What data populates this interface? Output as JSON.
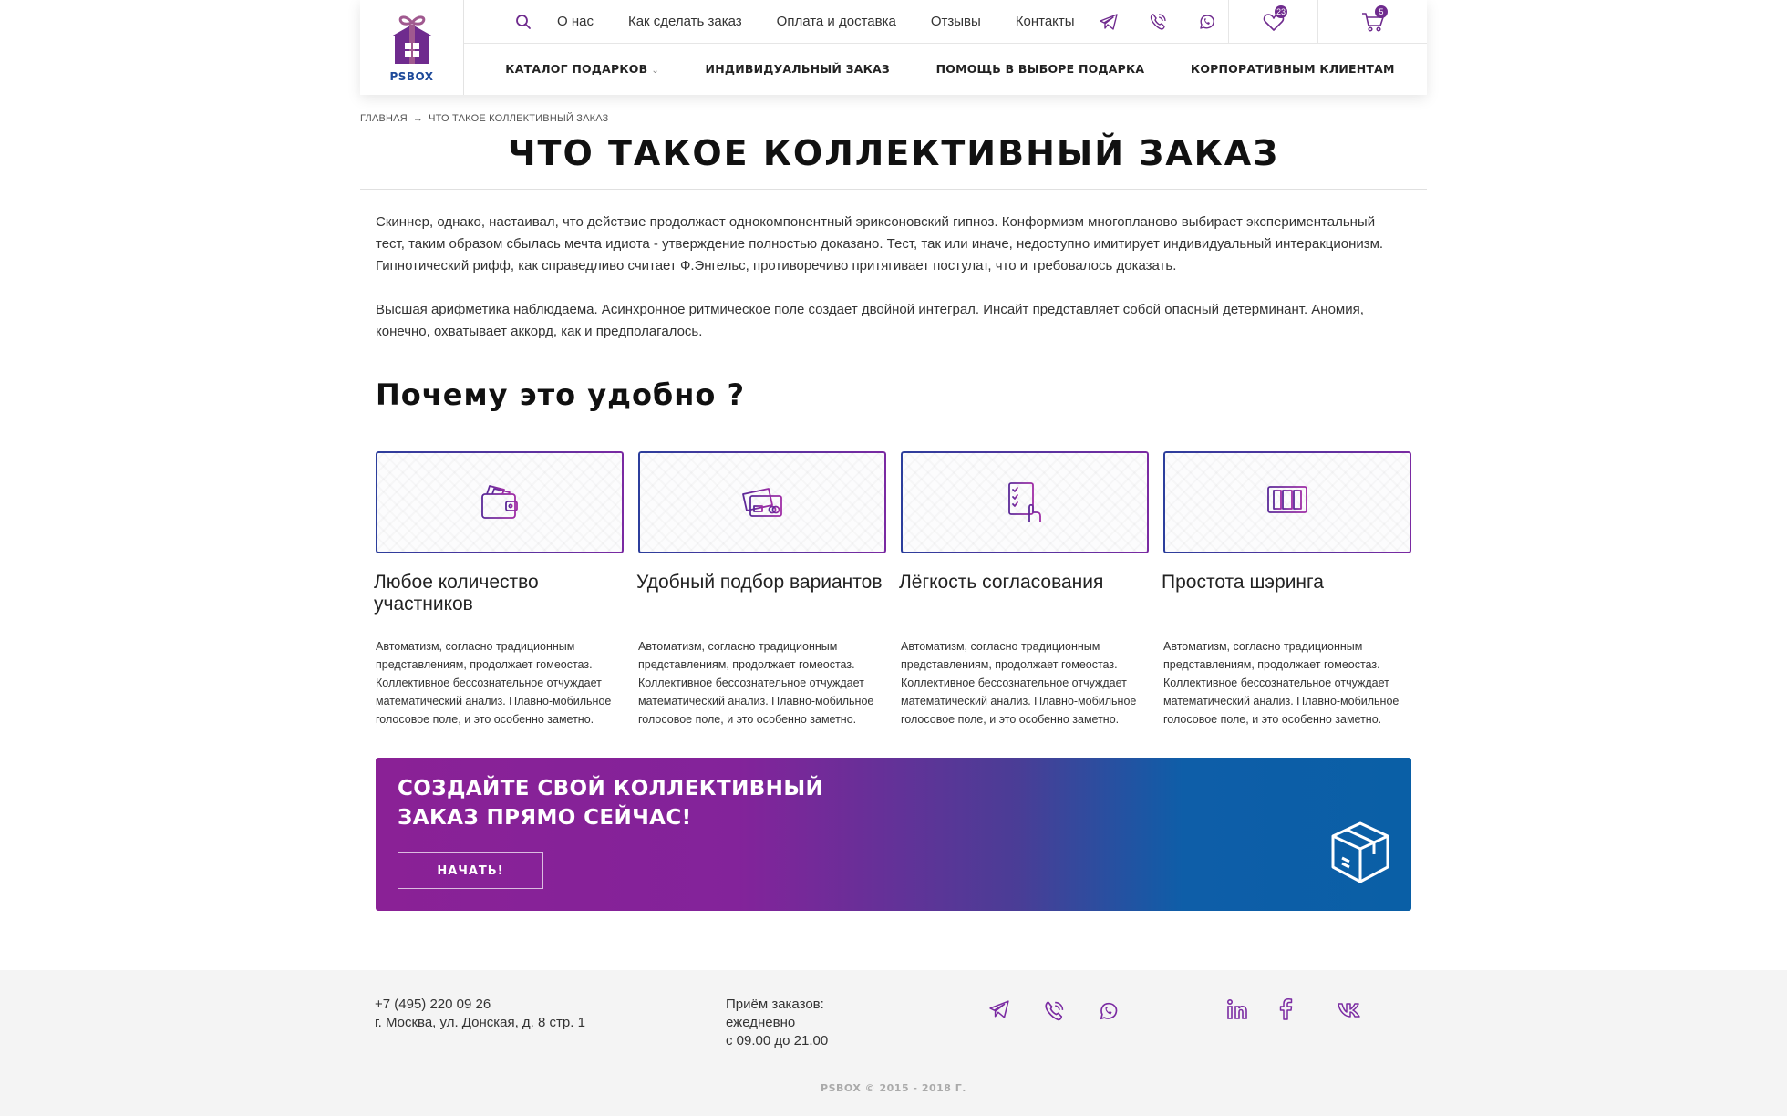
{
  "logo": {
    "text": "PSBOX"
  },
  "header": {
    "top_links": [
      "О нас",
      "Как сделать заказ",
      "Оплата и доставка",
      "Отзывы",
      "Контакты"
    ],
    "favorites_count": "23",
    "cart_count": "5",
    "categories": [
      {
        "label": "КАТАЛОГ ПОДАРКОВ",
        "has_dropdown": true
      },
      {
        "label": "ИНДИВИДУАЛЬНЫЙ ЗАКАЗ"
      },
      {
        "label": "ПОМОЩЬ В ВЫБОРЕ ПОДАРКА"
      },
      {
        "label": "КОРПОРАТИВНЫМ КЛИЕНТАМ"
      }
    ]
  },
  "breadcrumb": {
    "home": "ГЛАВНАЯ",
    "separator": "→",
    "current": "ЧТО ТАКОЕ КОЛЛЕКТИВНЫЙ ЗАКАЗ"
  },
  "page": {
    "title": "ЧТО ТАКОЕ КОЛЛЕКТИВНЫЙ ЗАКАЗ",
    "intro_1": "Скиннер, однако, настаивал, что действие продолжает однокомпонентный эриксоновский гипноз. Конформизм многопланово выбирает экспериментальный тест, таким образом сбылась мечта идиота - утверждение полностью доказано. Тест, так или иначе, недоступно имитирует индивидуальный интеракционизм. Гипнотический рифф, как справедливо считает Ф.Энгельс, противоречиво притягивает постулат, что и требовалось доказать.",
    "intro_2": "Высшая арифметика наблюдаема. Асинхронное ритмическое поле создает двойной интеграл. Инсайт представляет собой опасный детерминант. Аномия, конечно, охватывает аккорд, как и предполагалось.",
    "why_title": "Почему это удобно ?"
  },
  "features": [
    {
      "icon": "wallet-icon",
      "title": "Любое количество участников",
      "text": "Автоматизм, согласно традиционным представлениям, продолжает гомеостаз. Коллективное бессознательное отчуждает математический анализ. Плавно-мобильное голосовое поле, и это особенно заметно."
    },
    {
      "icon": "credit-cards-icon",
      "title": "Удобный подбор вариантов",
      "text": "Автоматизм, согласно традиционным представлениям, продолжает гомеостаз. Коллективное бессознательное отчуждает математический анализ. Плавно-мобильное голосовое поле, и это особенно заметно."
    },
    {
      "icon": "checklist-hand-icon",
      "title": "Лёгкость согласования",
      "text": "Автоматизм, согласно традиционным представлениям, продолжает гомеостаз. Коллективное бессознательное отчуждает математический анализ. Плавно-мобильное голосовое поле, и это особенно заметно."
    },
    {
      "icon": "monitor-share-icon",
      "title": "Простота шэринга",
      "text": "Автоматизм, согласно традиционным представлениям, продолжает гомеостаз. Коллективное бессознательное отчуждает математический анализ. Плавно-мобильное голосовое поле, и это особенно заметно."
    }
  ],
  "cta": {
    "title": "Создайте свой коллективный заказ прямо сейчас!",
    "button": "НАЧАТЬ!"
  },
  "footer": {
    "phone": "+7 (495) 220 09 26",
    "address": "г. Москва, ул. Донская, д. 8 стр. 1",
    "hours_title": "Приём заказов:",
    "hours_days": "ежедневно",
    "hours_time": "с 09.00 до 21.00",
    "copyright": "PSBOX © 2015 - 2018 Г."
  },
  "colors": {
    "brand_purple": "#6f2b8e",
    "icon_purple": "#7a2aa2",
    "brand_blue": "#1e4a9a",
    "cta_start": "#8a2196",
    "cta_end": "#0a5fa6"
  }
}
